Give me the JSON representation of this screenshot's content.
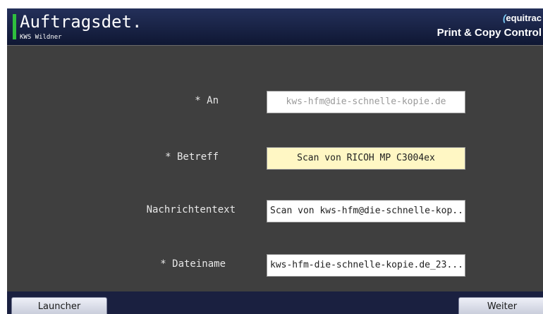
{
  "header": {
    "title": "Auftragsdet.",
    "user": "KWS Wildner",
    "brand": "equitrac",
    "brand_sub": "Print & Copy Control"
  },
  "form": {
    "fields": [
      {
        "label": "* An",
        "value": "kws-hfm@die-schnelle-kopie.de"
      },
      {
        "label": "* Betreff",
        "value": "Scan von RICOH MP C3004ex"
      },
      {
        "label": "Nachrichtentext",
        "value": "Scan von kws-hfm@die-schnelle-kop..."
      },
      {
        "label": "* Dateiname",
        "value": "kws-hfm-die-schnelle-kopie.de_23...."
      }
    ]
  },
  "footer": {
    "launcher_label": "Launcher",
    "next_label": "Weiter"
  },
  "colors": {
    "header_bg": "#1a2448",
    "accent_bar": "#2fbf3e",
    "highlight_field": "#fff7c4",
    "content_bg": "#3f3f3f"
  }
}
